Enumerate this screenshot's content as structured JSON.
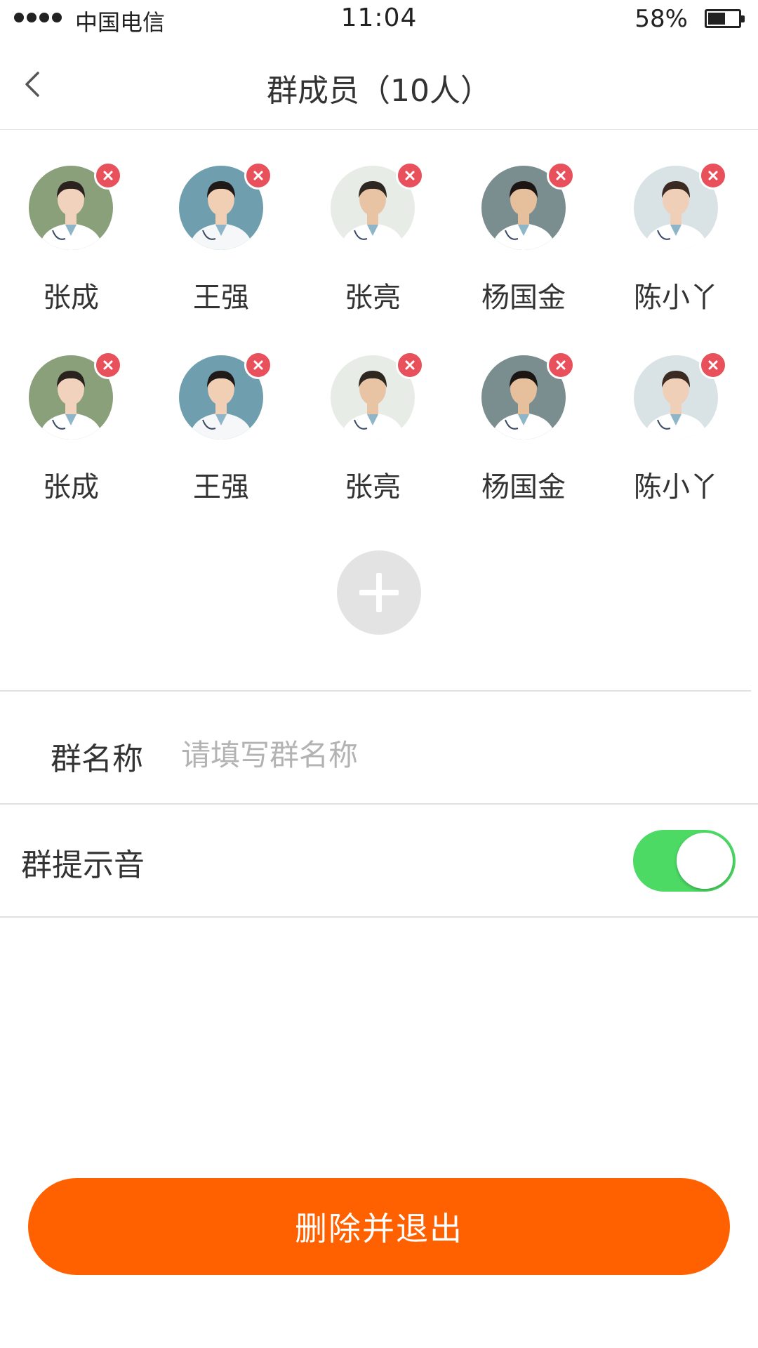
{
  "status_bar": {
    "carrier": "中国电信",
    "time": "11:04",
    "battery": "58%",
    "battery_level": 0.58
  },
  "nav": {
    "title": "群成员（10人）",
    "back_icon": "chevron-left-icon"
  },
  "members": [
    {
      "name": "张成",
      "avatar_colors": {
        "bg": "#8aa07a",
        "skin": "#f1d2bc",
        "hair": "#2a221e",
        "coat": "#ffffff"
      }
    },
    {
      "name": "王强",
      "avatar_colors": {
        "bg": "#6f9fae",
        "skin": "#f0cfb5",
        "hair": "#1f1a17",
        "coat": "#f5f7f8"
      }
    },
    {
      "name": "张亮",
      "avatar_colors": {
        "bg": "#e8ece6",
        "skin": "#e8c4a4",
        "hair": "#2d2621",
        "coat": "#ffffff"
      }
    },
    {
      "name": "杨国金",
      "avatar_colors": {
        "bg": "#7a8e8f",
        "skin": "#e6bf9d",
        "hair": "#1b1613",
        "coat": "#ffffff"
      }
    },
    {
      "name": "陈小丫",
      "avatar_colors": {
        "bg": "#d9e3e6",
        "skin": "#efcfb8",
        "hair": "#3a2a22",
        "coat": "#ffffff"
      }
    },
    {
      "name": "张成",
      "avatar_colors": {
        "bg": "#8aa07a",
        "skin": "#f1d2bc",
        "hair": "#2a221e",
        "coat": "#ffffff"
      }
    },
    {
      "name": "王强",
      "avatar_colors": {
        "bg": "#6f9fae",
        "skin": "#f0cfb5",
        "hair": "#1f1a17",
        "coat": "#f5f7f8"
      }
    },
    {
      "name": "张亮",
      "avatar_colors": {
        "bg": "#e8ece6",
        "skin": "#e8c4a4",
        "hair": "#2d2621",
        "coat": "#ffffff"
      }
    },
    {
      "name": "杨国金",
      "avatar_colors": {
        "bg": "#7a8e8f",
        "skin": "#e6bf9d",
        "hair": "#1b1613",
        "coat": "#ffffff"
      }
    },
    {
      "name": "陈小丫",
      "avatar_colors": {
        "bg": "#d9e3e6",
        "skin": "#efcfb8",
        "hair": "#3a2a22",
        "coat": "#ffffff"
      }
    }
  ],
  "icons": {
    "remove": "remove-member-icon",
    "add": "plus-icon"
  },
  "group_name": {
    "label": "群名称",
    "value": "",
    "placeholder": "请填写群名称"
  },
  "group_sound": {
    "label": "群提示音",
    "enabled": true
  },
  "actions": {
    "exit_label": "删除并退出"
  },
  "colors": {
    "accent": "#ff6000",
    "toggle_on": "#4cd964",
    "remove_badge": "#e8505b",
    "add_button": "#e3e3e3",
    "placeholder": "#b3b3b3"
  }
}
